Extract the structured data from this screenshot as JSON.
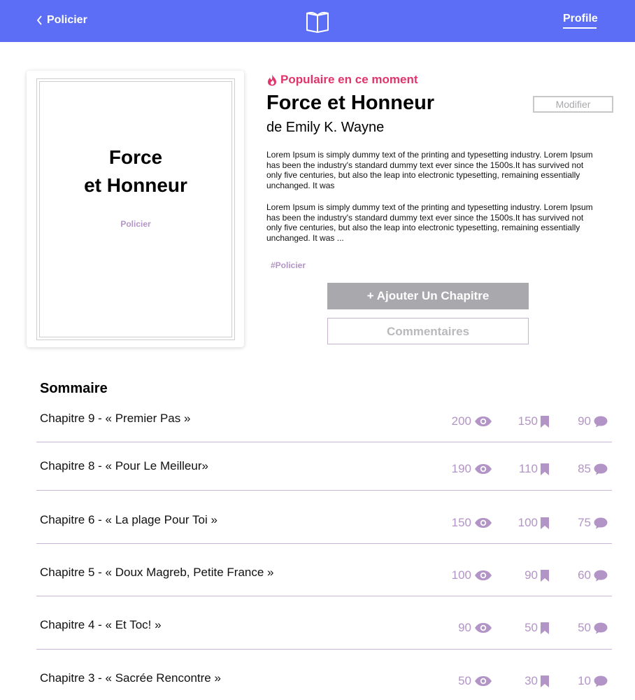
{
  "header": {
    "back_label": "Policier",
    "profile_label": "Profile",
    "background": "#5b6ef5",
    "logo_icon": "open-book-icon"
  },
  "cover": {
    "title_line1": "Force",
    "title_line2": "et Honneur",
    "genre": "Policier"
  },
  "book": {
    "badge": "Populaire en ce moment",
    "badge_icon": "flame-icon",
    "badge_color": "#e0356b",
    "title": "Force et Honneur",
    "author": "de Emily K. Wayne",
    "edit_label": "Modifier",
    "description_1": "Lorem Ipsum is simply dummy text of the printing and typesetting industry. Lorem Ipsum has been the industry's standard dummy text ever since the 1500s.It has survived not only five centuries, but also the leap into electronic typesetting, remaining essentially unchanged. It was",
    "description_2": "Lorem Ipsum is simply dummy text of the printing and typesetting industry. Lorem Ipsum has been the industry's standard dummy text ever since the 1500s.It has survived not only five centuries, but also the leap into electronic typesetting, remaining essentially unchanged. It was ...",
    "tag": "#Policier",
    "add_chapter_label": "+ Ajouter Un Chapitre",
    "comments_label": "Commentaires"
  },
  "summary": {
    "title": "Sommaire",
    "stat_icons": [
      "eye-icon",
      "bookmark-icon",
      "comment-icon"
    ],
    "accent": "#b394c6",
    "chapters": [
      {
        "title": "Chapitre 9 - « Premier Pas »",
        "views": "200",
        "bookmarks": "150",
        "comments": "90"
      },
      {
        "title": "Chapitre 8 - « Pour Le Meilleur»",
        "views": "190",
        "bookmarks": "110",
        "comments": "85"
      },
      {
        "title": "Chapitre 6 - « La plage Pour Toi »",
        "views": "150",
        "bookmarks": "100",
        "comments": "75"
      },
      {
        "title": "Chapitre 5 - « Doux Magreb, Petite France »",
        "views": "100",
        "bookmarks": "90",
        "comments": "60"
      },
      {
        "title": "Chapitre 4 - « Et Toc! »",
        "views": "90",
        "bookmarks": "50",
        "comments": "50"
      },
      {
        "title": "Chapitre 3 - « Sacrée Rencontre »",
        "views": "50",
        "bookmarks": "30",
        "comments": "10"
      }
    ]
  }
}
